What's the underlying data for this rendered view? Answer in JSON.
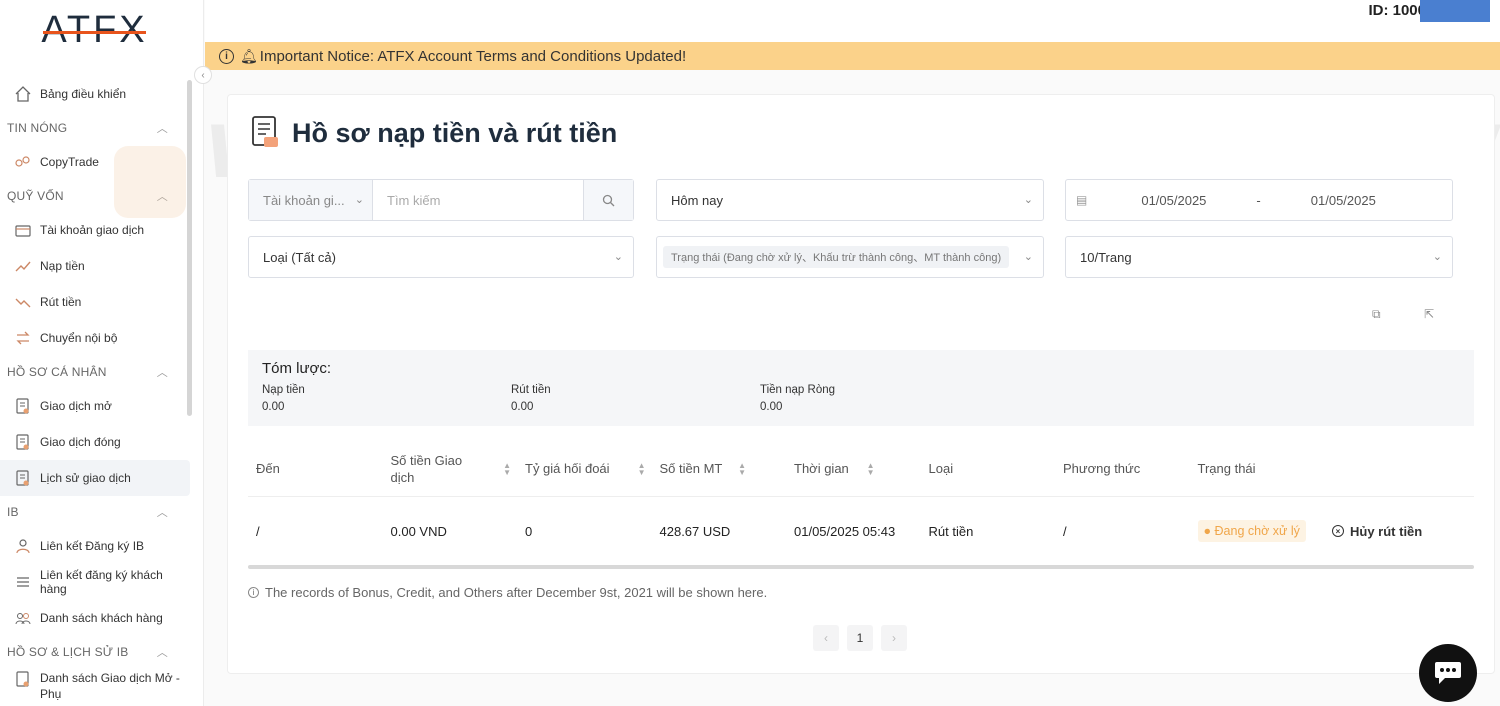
{
  "brand": {
    "logo": "ATFX"
  },
  "user": {
    "id_label": "ID: 1000"
  },
  "notice": {
    "text": "Important Notice: ATFX Account Terms and Conditions Updated!"
  },
  "sidebar": {
    "items": [
      {
        "label": "Bảng điều khiển",
        "icon": "home-icon"
      },
      {
        "section": "TIN NÓNG"
      },
      {
        "label": "CopyTrade",
        "icon": "copytrade-icon"
      },
      {
        "section": "QUỸ VỐN"
      },
      {
        "label": "Tài khoản giao dịch",
        "icon": "account-icon"
      },
      {
        "label": "Nạp tiền",
        "icon": "deposit-icon"
      },
      {
        "label": "Rút tiền",
        "icon": "withdraw-icon"
      },
      {
        "label": "Chuyển nội bộ",
        "icon": "transfer-icon"
      },
      {
        "section": "HỒ SƠ CÁ NHÂN"
      },
      {
        "label": "Giao dịch mở",
        "icon": "document-icon"
      },
      {
        "label": "Giao dịch đóng",
        "icon": "document-icon"
      },
      {
        "label": "Lịch sử giao dịch",
        "icon": "document-icon"
      },
      {
        "section": "IB"
      },
      {
        "label": "Liên kết Đăng ký IB",
        "icon": "link-icon"
      },
      {
        "label": "Liên kết đăng ký khách hàng",
        "icon": "list-icon"
      },
      {
        "label": "Danh sách khách hàng",
        "icon": "users-icon"
      },
      {
        "section": "HỒ SƠ & LỊCH SỬ IB"
      },
      {
        "label": "Danh sách Giao dịch Mở - Phụ",
        "icon": "document-icon"
      }
    ]
  },
  "page": {
    "title": "Hồ sơ nạp tiền và rút tiền"
  },
  "filters": {
    "account_select": "Tài khoản gi...",
    "search_placeholder": "Tìm kiếm",
    "period": "Hôm nay",
    "date_from": "01/05/2025",
    "date_separator": "-",
    "date_to": "01/05/2025",
    "type": "Loại (Tất cả)",
    "status": "Trạng thái (Đang chờ xử lý、Khấu trừ thành công、MT thành công)",
    "page_size": "10/Trang"
  },
  "summary": {
    "title": "Tóm lược:",
    "deposit_label": "Nạp tiền",
    "deposit_value": "0.00",
    "withdraw_label": "Rút tiền",
    "withdraw_value": "0.00",
    "net_label": "Tiền nạp Ròng",
    "net_value": "0.00"
  },
  "table": {
    "headers": [
      "Đến",
      "Số tiền Giao dịch",
      "Tỷ giá hối đoái",
      "Số tiền MT",
      "Thời gian",
      "Loại",
      "Phương thức",
      "Trạng thái"
    ],
    "rows": [
      {
        "to": "/",
        "amount": "0.00 VND",
        "rate": "0",
        "mt_amount": "428.67 USD",
        "time": "01/05/2025 05:43",
        "type": "Rút tiền",
        "method": "/",
        "status": "Đang chờ xử lý",
        "action": "Hủy rút tiền"
      }
    ]
  },
  "footer_note": "The records of Bonus, Credit, and Others after December 9st, 2021 will be shown here.",
  "pagination": {
    "current": "1"
  },
  "watermark": "WikiFX",
  "colors": {
    "notice_bg": "#fbd28a",
    "status_pending": "#f0a64a",
    "accent": "#e8541c"
  }
}
